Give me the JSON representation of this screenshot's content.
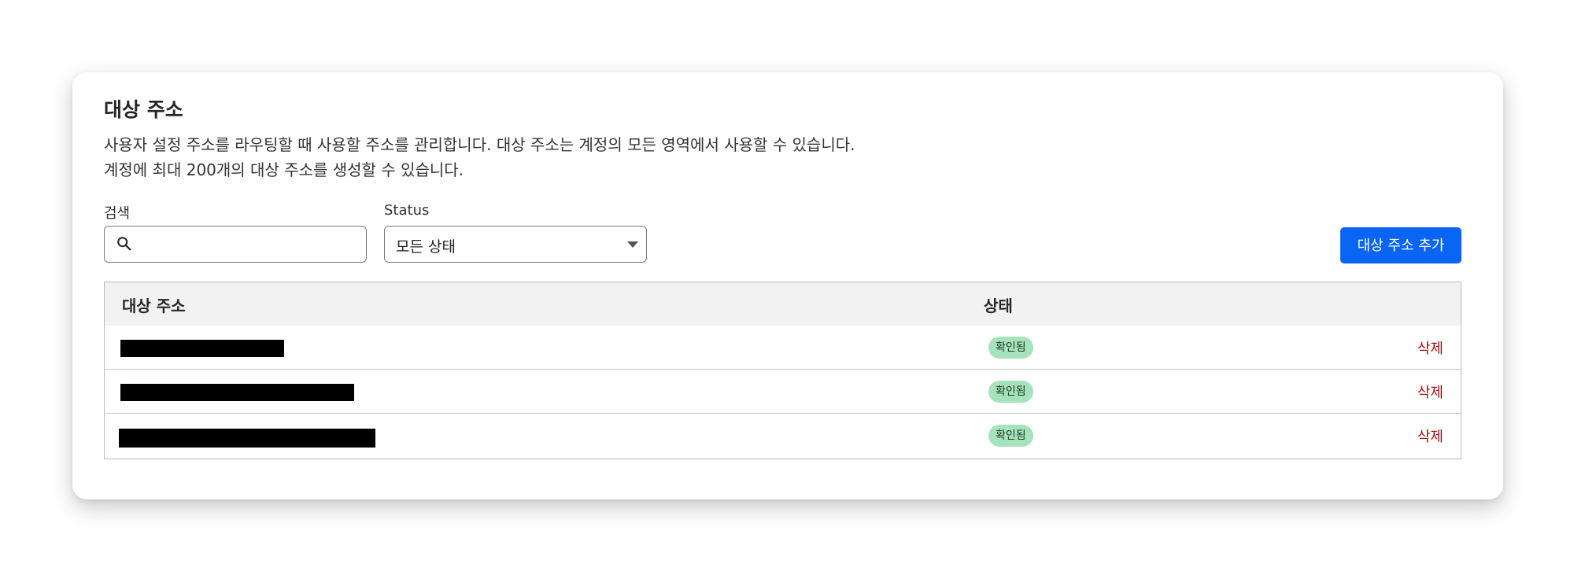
{
  "card": {
    "title": "대상 주소",
    "description_line1": "사용자 설정 주소를 라우팅할 때 사용할 주소를 관리합니다. 대상 주소는 계정의 모든 영역에서 사용할 수 있습니다.",
    "description_line2": "계정에 최대 200개의 대상 주소를 생성할 수 있습니다."
  },
  "filters": {
    "search_label": "검색",
    "search_value": "",
    "search_placeholder": "",
    "search_icon": "search-icon",
    "status_label": "Status",
    "status_selected": "모든 상태"
  },
  "actions": {
    "add_button_label": "대상 주소 추가"
  },
  "table": {
    "columns": {
      "address": "대상 주소",
      "status": "상태"
    },
    "rows": [
      {
        "address": "[redacted]",
        "status": "확인됨",
        "delete_label": "삭제"
      },
      {
        "address": "[redacted]",
        "status": "확인됨",
        "delete_label": "삭제"
      },
      {
        "address": "[redacted]",
        "status": "확인됨",
        "delete_label": "삭제"
      }
    ]
  },
  "colors": {
    "primary_button": "#0a64f4",
    "verified_badge_bg": "#a6e3bd",
    "delete_link": "#a31515",
    "header_bg": "#f2f2f2"
  }
}
